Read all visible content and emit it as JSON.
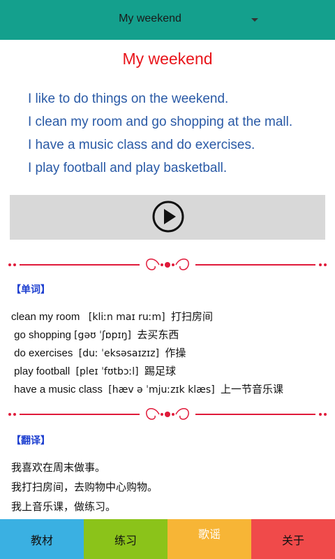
{
  "header": {
    "title": "My weekend"
  },
  "lesson": {
    "title": "My weekend",
    "sentences": [
      "I like to do things on the weekend.",
      "I clean my room and go shopping at the mall.",
      "I have a music class and do exercises.",
      "I play football and play basketball."
    ]
  },
  "player": {
    "icon": "play-icon"
  },
  "vocabulary": {
    "label": "【单词】",
    "items": [
      {
        "word": "clean my room",
        "ipa": "[kliːn maɪ ruːm]",
        "meaning": "打扫房间"
      },
      {
        "word": "go shopping",
        "ipa": "[gəʊ ˈʃɒpɪŋ]",
        "meaning": "去买东西"
      },
      {
        "word": "do exercises",
        "ipa": "[duː ˈeksəsaɪzɪz]",
        "meaning": "作操"
      },
      {
        "word": "play football",
        "ipa": "[pleɪ ˈfʊtbɔːl]",
        "meaning": "踢足球"
      },
      {
        "word": "have a music class",
        "ipa": "[hæv ə ˈmjuːzɪk klæs]",
        "meaning": "上一节音乐课"
      }
    ]
  },
  "translation": {
    "label": "【翻译】",
    "lines": [
      "我喜欢在周末做事。",
      "我打扫房间，去购物中心购物。",
      "我上音乐课，做练习。"
    ]
  },
  "tabs": [
    {
      "label": "教材",
      "color": "#3ab0e2"
    },
    {
      "label": "练习",
      "color": "#8bc31a"
    },
    {
      "label": "歌谣",
      "color": "#f7b536"
    },
    {
      "label": "关于",
      "color": "#f04a4a"
    }
  ]
}
